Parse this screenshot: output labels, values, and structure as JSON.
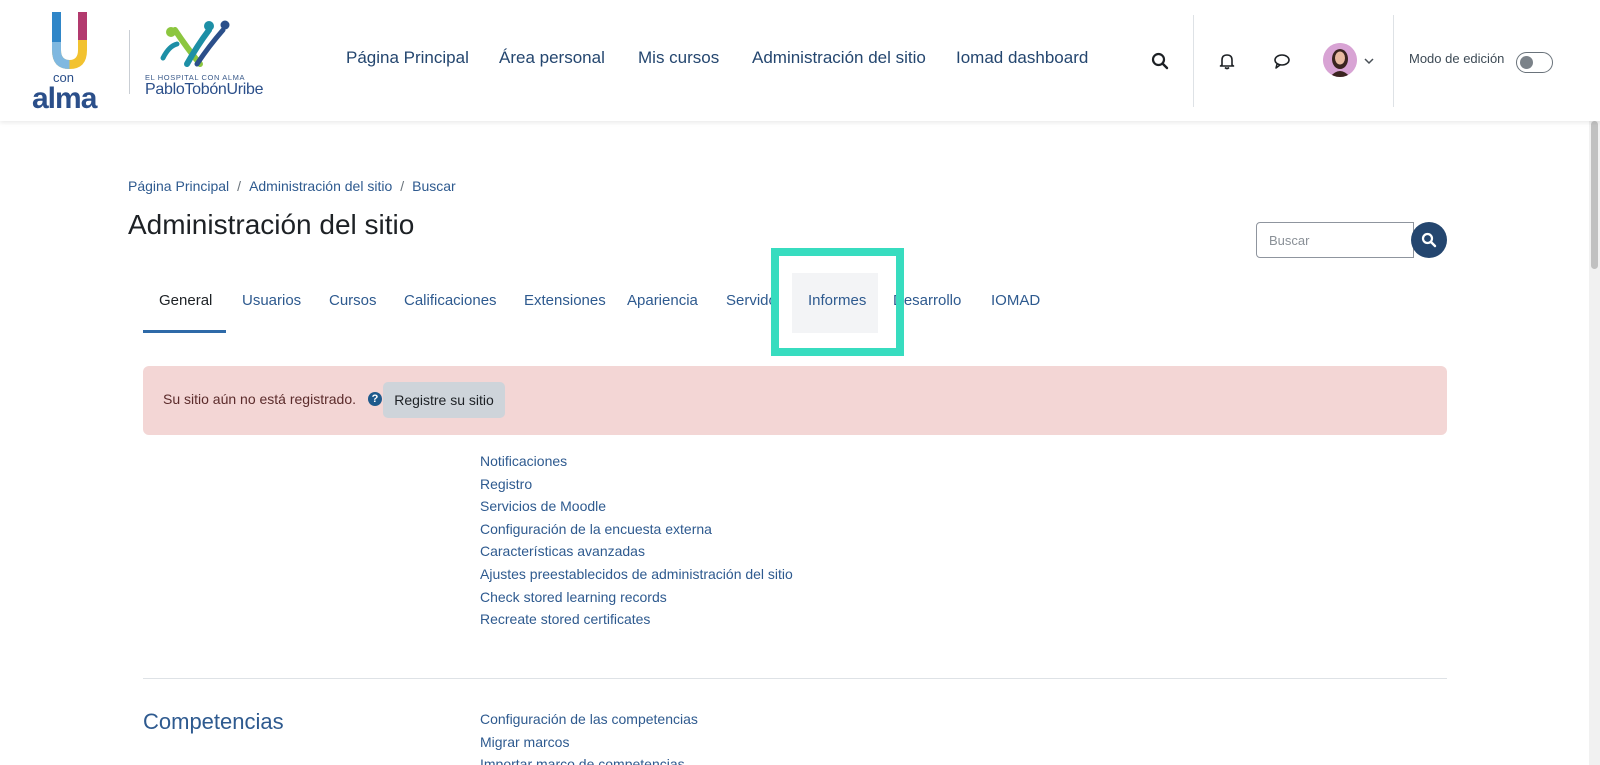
{
  "header": {
    "logo_u_text": "con",
    "logo_alma_text": "alma",
    "hptu_tagline": "EL HOSPITAL CON ALMA",
    "hptu_name": "PabloTobónUribe",
    "nav": [
      {
        "label": "Página Principal"
      },
      {
        "label": "Área personal"
      },
      {
        "label": "Mis cursos"
      },
      {
        "label": "Administración del sitio"
      },
      {
        "label": "Iomad dashboard"
      }
    ],
    "edit_mode_label": "Modo de edición",
    "icons": [
      "search-icon",
      "bell-icon",
      "chat-icon",
      "avatar",
      "chevron-down-icon"
    ]
  },
  "breadcrumb": {
    "items": [
      "Página Principal",
      "Administración del sitio",
      "Buscar"
    ],
    "separator": "/"
  },
  "page": {
    "title": "Administración del sitio",
    "search_placeholder": "Buscar"
  },
  "tabs": [
    {
      "label": "General",
      "active": true
    },
    {
      "label": "Usuarios"
    },
    {
      "label": "Cursos"
    },
    {
      "label": "Calificaciones"
    },
    {
      "label": "Extensiones"
    },
    {
      "label": "Apariencia"
    },
    {
      "label": "Servido"
    },
    {
      "label": "Informes",
      "highlighted": true
    },
    {
      "label": "Desarrollo"
    },
    {
      "label": "IOMAD"
    }
  ],
  "alert": {
    "text": "Su sitio aún no está registrado.",
    "button": "Registre su sitio"
  },
  "general_links": [
    "Notificaciones",
    "Registro",
    "Servicios de Moodle",
    "Configuración de la encuesta externa",
    "Características avanzadas",
    "Ajustes preestablecidos de administración del sitio",
    "Check stored learning records",
    "Recreate stored certificates"
  ],
  "competencias": {
    "title": "Competencias",
    "links": [
      "Configuración de las competencias",
      "Migrar marcos",
      "Importar marco de competencias"
    ]
  },
  "colors": {
    "primary": "#24466f",
    "link": "#2e5a8f",
    "alert_bg": "#f3d6d5",
    "highlight": "#37dcbf"
  }
}
